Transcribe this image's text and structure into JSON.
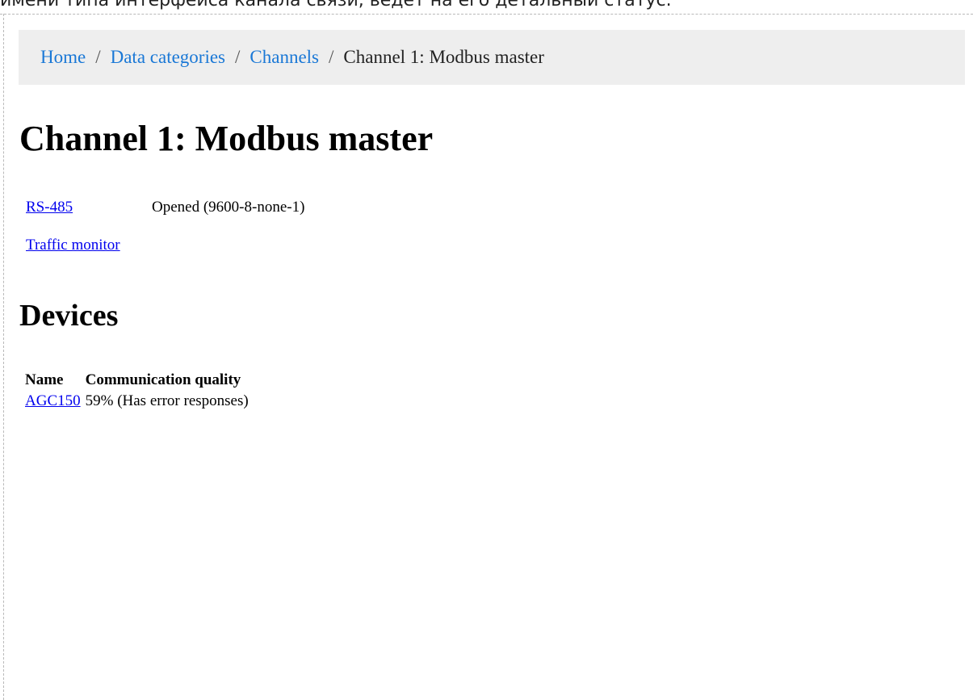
{
  "caption": "имени типа интерфейса канала связи, ведет на его детальный статус.",
  "breadcrumb": {
    "items": [
      "Home",
      "Data categories",
      "Channels"
    ],
    "current": "Channel 1: Modbus master",
    "separator": "/"
  },
  "page_title": "Channel 1: Modbus master",
  "channel": {
    "interface_link": "RS-485",
    "interface_status": "Opened (9600-8-none-1)",
    "traffic_monitor_link": "Traffic monitor"
  },
  "devices": {
    "heading": "Devices",
    "columns": [
      "Name",
      "Communication quality"
    ],
    "rows": [
      {
        "name": "AGC150",
        "quality": "59% (Has error responses)"
      }
    ]
  }
}
